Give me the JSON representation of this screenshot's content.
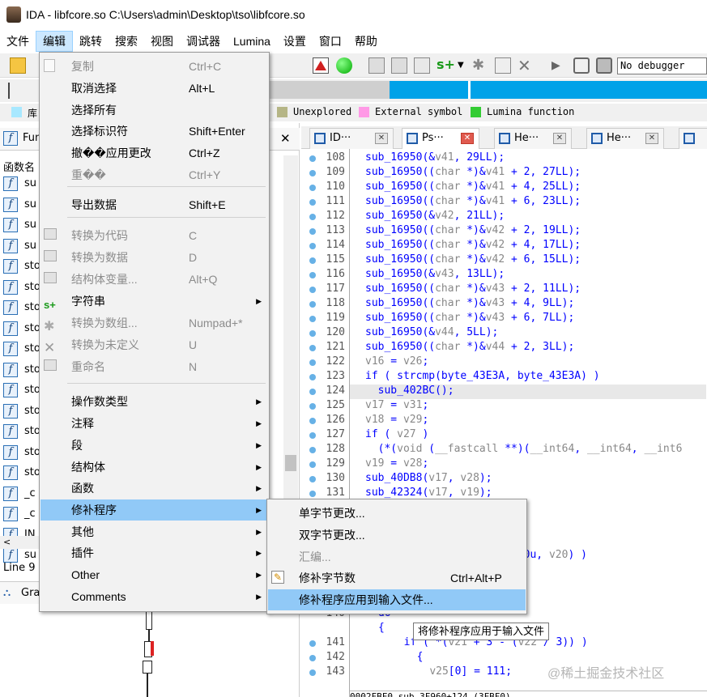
{
  "window": {
    "title": "IDA - libfcore.so C:\\Users\\admin\\Desktop\\tso\\libfcore.so"
  },
  "menubar": [
    "文件",
    "编辑",
    "跳转",
    "搜索",
    "视图",
    "调试器",
    "Lumina",
    "设置",
    "窗口",
    "帮助"
  ],
  "toolbar": {
    "debugger_select": "No debugger"
  },
  "legend": [
    {
      "label": "库",
      "color": "#a8e8ff"
    },
    {
      "label": "Unexplored",
      "color": "#b5b586"
    },
    {
      "label": "External symbol",
      "color": "#ff99e6"
    },
    {
      "label": "Lumina function",
      "color": "#33cc33"
    }
  ],
  "left_pane": {
    "title": "Fun",
    "column_header": "函数名",
    "functions": [
      "su",
      "su",
      "su",
      "su",
      "sto",
      "sto",
      "sto",
      "sto",
      "sto",
      "sto",
      "sto",
      "sto",
      "sto",
      "sto",
      "sto",
      "_c",
      "_c",
      "JN",
      "su"
    ],
    "status_line": "Line 9",
    "graph_tab": "Gra"
  },
  "tabs": [
    {
      "label": "ID···",
      "active": false
    },
    {
      "label": "Ps···",
      "active": true
    },
    {
      "label": "He···",
      "active": false
    },
    {
      "label": "He···",
      "active": false
    }
  ],
  "code": [
    {
      "ln": "108",
      "text": "sub_16950(&v41, 29LL);",
      "dot": true
    },
    {
      "ln": "109",
      "text": "sub_16950((char *)&v41 + 2, 27LL);",
      "dot": true
    },
    {
      "ln": "110",
      "text": "sub_16950((char *)&v41 + 4, 25LL);",
      "dot": true
    },
    {
      "ln": "111",
      "text": "sub_16950((char *)&v41 + 6, 23LL);",
      "dot": true
    },
    {
      "ln": "112",
      "text": "sub_16950(&v42, 21LL);",
      "dot": true
    },
    {
      "ln": "113",
      "text": "sub_16950((char *)&v42 + 2, 19LL);",
      "dot": true
    },
    {
      "ln": "114",
      "text": "sub_16950((char *)&v42 + 4, 17LL);",
      "dot": true
    },
    {
      "ln": "115",
      "text": "sub_16950((char *)&v42 + 6, 15LL);",
      "dot": true
    },
    {
      "ln": "116",
      "text": "sub_16950(&v43, 13LL);",
      "dot": true
    },
    {
      "ln": "117",
      "text": "sub_16950((char *)&v43 + 2, 11LL);",
      "dot": true
    },
    {
      "ln": "118",
      "text": "sub_16950((char *)&v43 + 4, 9LL);",
      "dot": true
    },
    {
      "ln": "119",
      "text": "sub_16950((char *)&v43 + 6, 7LL);",
      "dot": true
    },
    {
      "ln": "120",
      "text": "sub_16950(&v44, 5LL);",
      "dot": true
    },
    {
      "ln": "121",
      "text": "sub_16950((char *)&v44 + 2, 3LL);",
      "dot": true
    },
    {
      "ln": "122",
      "text": "v16 = v26;",
      "dot": true
    },
    {
      "ln": "123",
      "text": "if ( strcmp(byte_43E3A, byte_43E3A) )",
      "dot": true
    },
    {
      "ln": "124",
      "text": "  sub_402BC();",
      "dot": true,
      "hl": true
    },
    {
      "ln": "125",
      "text": "v17 = v31;",
      "dot": true
    },
    {
      "ln": "126",
      "text": "v18 = v29;",
      "dot": true
    },
    {
      "ln": "127",
      "text": "if ( v27 )",
      "dot": true
    },
    {
      "ln": "128",
      "text": "  (*(void (__fastcall **)(__int64, __int64, __int6",
      "dot": true
    },
    {
      "ln": "129",
      "text": "v19 = v28;",
      "dot": true
    },
    {
      "ln": "130",
      "text": "sub_40DB8(v17, v28);",
      "dot": true
    },
    {
      "ln": "131",
      "text": "sub_42324(v17, v19);",
      "dot": true
    }
  ],
  "code_lower": [
    {
      "ln": "",
      "text": "400u, v20) )",
      "dot": false
    },
    {
      "ln": "140",
      "text": "do",
      "dot": false
    },
    {
      "ln": "",
      "text": "{",
      "dot": false
    },
    {
      "ln": "141",
      "text": "  if ( *(v21 + 3 - (v22 / 3)) )",
      "dot": true
    },
    {
      "ln": "142",
      "text": "  {",
      "dot": true
    },
    {
      "ln": "143",
      "text": "    v25[0] = 111;",
      "dot": true
    }
  ],
  "code_status": "0002FBF0 sub_3F960+124 (3FBF0)",
  "edit_menu": [
    {
      "label": "复制",
      "shortcut": "Ctrl+C",
      "disabled": true,
      "icon": "copy-icon"
    },
    {
      "label": "取消选择",
      "shortcut": "Alt+L",
      "disabled": false
    },
    {
      "label": "选择所有",
      "shortcut": "",
      "disabled": false
    },
    {
      "label": "选择标识符",
      "shortcut": "Shift+Enter",
      "disabled": false
    },
    {
      "label": "撤��应用更改",
      "shortcut": "Ctrl+Z",
      "disabled": false
    },
    {
      "label": "重��",
      "shortcut": "Ctrl+Y",
      "disabled": true
    },
    {
      "sep": true
    },
    {
      "label": "导出数据",
      "shortcut": "Shift+E",
      "disabled": false
    },
    {
      "sep": true
    },
    {
      "label": "转换为代码",
      "shortcut": "C",
      "disabled": true,
      "icon": "code-icon"
    },
    {
      "label": "转换为数据",
      "shortcut": "D",
      "disabled": true,
      "icon": "data-icon"
    },
    {
      "label": "结构体变量...",
      "shortcut": "Alt+Q",
      "disabled": true,
      "icon": "struct-var-icon"
    },
    {
      "label": "字符串",
      "shortcut": "",
      "disabled": false,
      "submenu": true,
      "icon": "string-icon"
    },
    {
      "label": "转换为数组...",
      "shortcut": "Numpad+*",
      "disabled": true,
      "icon": "array-icon"
    },
    {
      "label": "转换为未定义",
      "shortcut": "U",
      "disabled": true,
      "icon": "undefine-icon"
    },
    {
      "label": "重命名",
      "shortcut": "N",
      "disabled": true,
      "icon": "rename-icon"
    },
    {
      "sep": true
    },
    {
      "label": "操作数类型",
      "shortcut": "",
      "disabled": false,
      "submenu": true
    },
    {
      "label": "注释",
      "shortcut": "",
      "disabled": false,
      "submenu": true
    },
    {
      "label": "段",
      "shortcut": "",
      "disabled": false,
      "submenu": true
    },
    {
      "label": "结构体",
      "shortcut": "",
      "disabled": false,
      "submenu": true
    },
    {
      "label": "函数",
      "shortcut": "",
      "disabled": false,
      "submenu": true
    },
    {
      "label": "修补程序",
      "shortcut": "",
      "disabled": false,
      "submenu": true,
      "selected": true
    },
    {
      "label": "其他",
      "shortcut": "",
      "disabled": false,
      "submenu": true
    },
    {
      "label": "插件",
      "shortcut": "",
      "disabled": false,
      "submenu": true
    },
    {
      "label": "Other",
      "shortcut": "",
      "disabled": false,
      "submenu": true
    },
    {
      "label": "Comments",
      "shortcut": "",
      "disabled": false,
      "submenu": true
    }
  ],
  "patch_menu": [
    {
      "label": "单字节更改...",
      "shortcut": "",
      "disabled": false
    },
    {
      "label": "双字节更改...",
      "shortcut": "",
      "disabled": false
    },
    {
      "label": "汇编...",
      "shortcut": "",
      "disabled": true
    },
    {
      "label": "修补字节数",
      "shortcut": "Ctrl+Alt+P",
      "disabled": false,
      "icon": "patch-bytes-icon"
    },
    {
      "label": "修补程序应用到输入文件...",
      "shortcut": "",
      "disabled": false,
      "selected": true
    }
  ],
  "tooltip": "将修补程序应用于输入文件",
  "watermark": "@稀土掘金技术社区"
}
